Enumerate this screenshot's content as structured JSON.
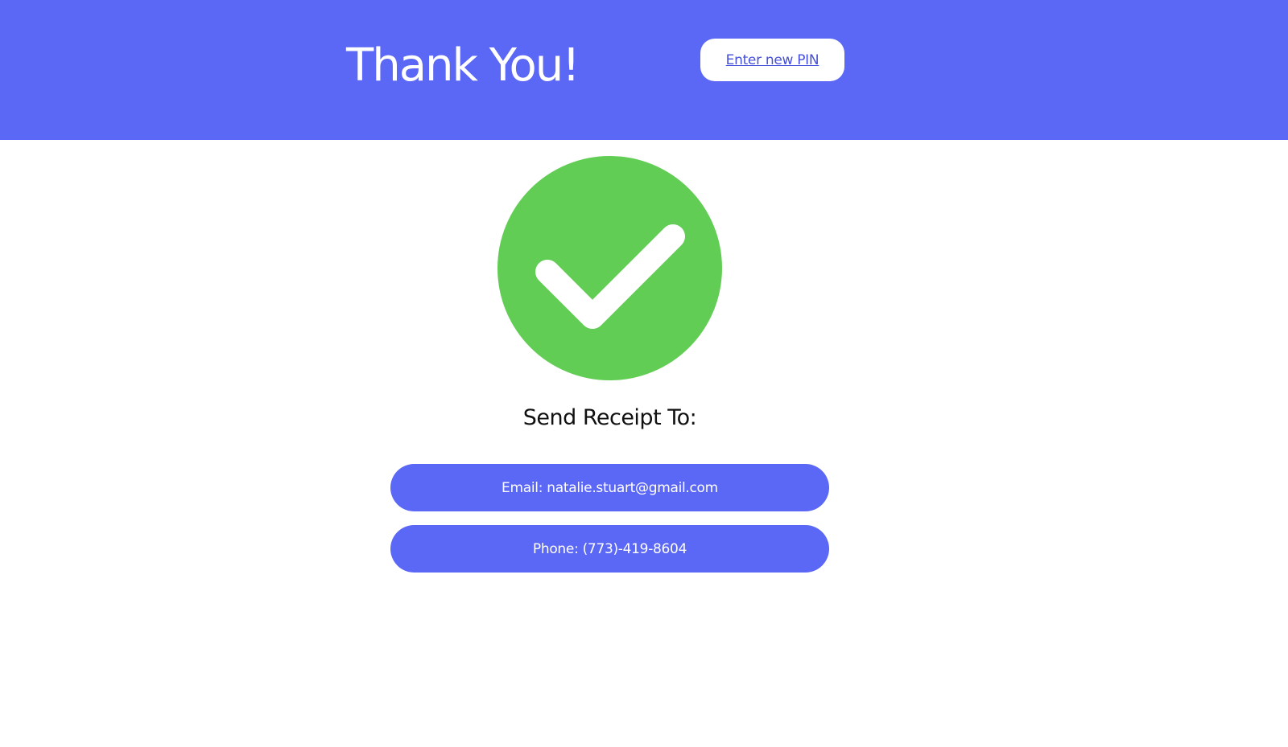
{
  "header": {
    "title": "Thank You!",
    "pin_link_label": "Enter new PIN"
  },
  "status": {
    "icon": "check-circle-icon",
    "success_color": "#62cd55"
  },
  "receipt": {
    "heading": "Send Receipt To:",
    "email_label": "Email: natalie.stuart@gmail.com",
    "phone_label": "Phone: (773)-419-8604"
  },
  "colors": {
    "accent": "#5b67f5",
    "link": "#4650d8",
    "background": "#ffffff"
  }
}
